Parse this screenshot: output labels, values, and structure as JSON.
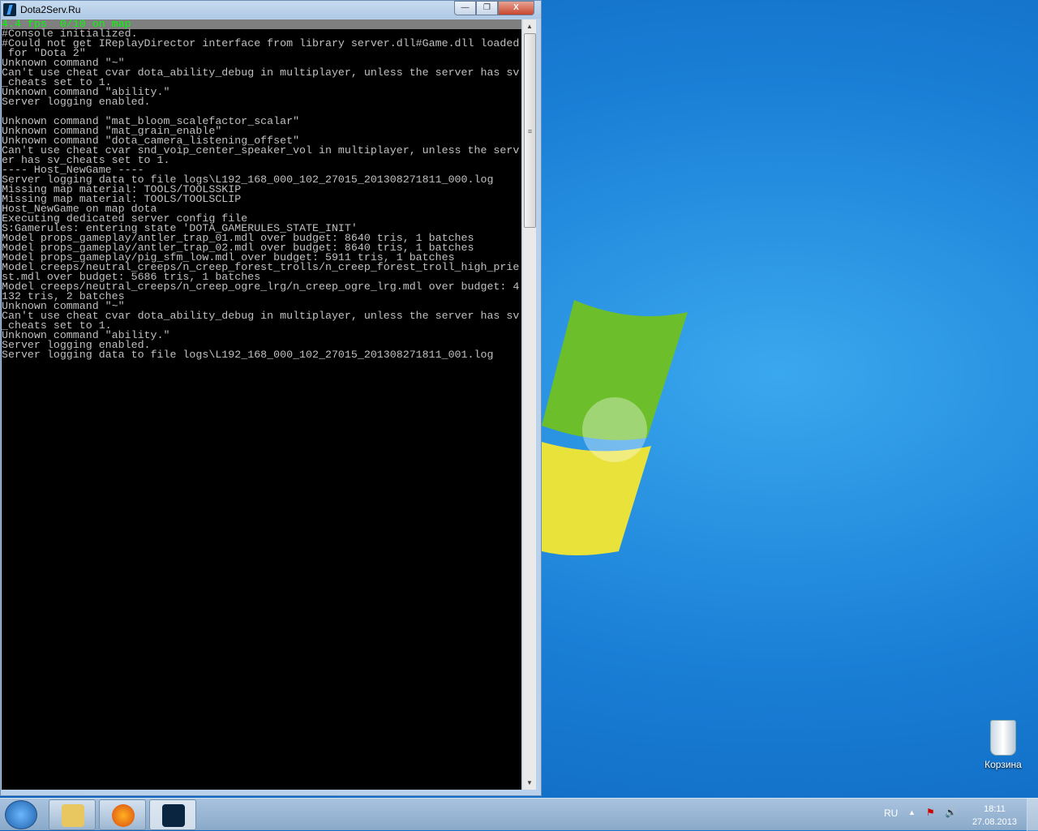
{
  "window": {
    "title": "Dota2Serv.Ru",
    "buttons": {
      "minimize": "—",
      "maximize": "❐",
      "close": "X"
    }
  },
  "console": {
    "status": "4.4 fps  0/10 on map",
    "lines": [
      "#Console initialized.",
      "#Could not get IReplayDirector interface from library server.dll#Game.dll loaded",
      " for \"Dota 2\"",
      "Unknown command \"~\"",
      "Can't use cheat cvar dota_ability_debug in multiplayer, unless the server has sv",
      "_cheats set to 1.",
      "Unknown command \"ability.\"",
      "Server logging enabled.",
      "",
      "Unknown command \"mat_bloom_scalefactor_scalar\"",
      "Unknown command \"mat_grain_enable\"",
      "Unknown command \"dota_camera_listening_offset\"",
      "Can't use cheat cvar snd_voip_center_speaker_vol in multiplayer, unless the serv",
      "er has sv_cheats set to 1.",
      "---- Host_NewGame ----",
      "Server logging data to file logs\\L192_168_000_102_27015_201308271811_000.log",
      "Missing map material: TOOLS/TOOLSSKIP",
      "Missing map material: TOOLS/TOOLSCLIP",
      "Host_NewGame on map dota",
      "Executing dedicated server config file",
      "S:Gamerules: entering state 'DOTA_GAMERULES_STATE_INIT'",
      "Model props_gameplay/antler_trap_01.mdl over budget: 8640 tris, 1 batches",
      "Model props_gameplay/antler_trap_02.mdl over budget: 8640 tris, 1 batches",
      "Model props_gameplay/pig_sfm_low.mdl over budget: 5911 tris, 1 batches",
      "Model creeps/neutral_creeps/n_creep_forest_trolls/n_creep_forest_troll_high_prie",
      "st.mdl over budget: 5686 tris, 1 batches",
      "Model creeps/neutral_creeps/n_creep_ogre_lrg/n_creep_ogre_lrg.mdl over budget: 4",
      "132 tris, 2 batches",
      "Unknown command \"~\"",
      "Can't use cheat cvar dota_ability_debug in multiplayer, unless the server has sv",
      "_cheats set to 1.",
      "Unknown command \"ability.\"",
      "Server logging enabled.",
      "Server logging data to file logs\\L192_168_000_102_27015_201308271811_001.log"
    ]
  },
  "desktop": {
    "recycle_bin": "Корзина"
  },
  "taskbar": {
    "language": "RU",
    "time": "18:11",
    "date": "27.08.2013"
  }
}
